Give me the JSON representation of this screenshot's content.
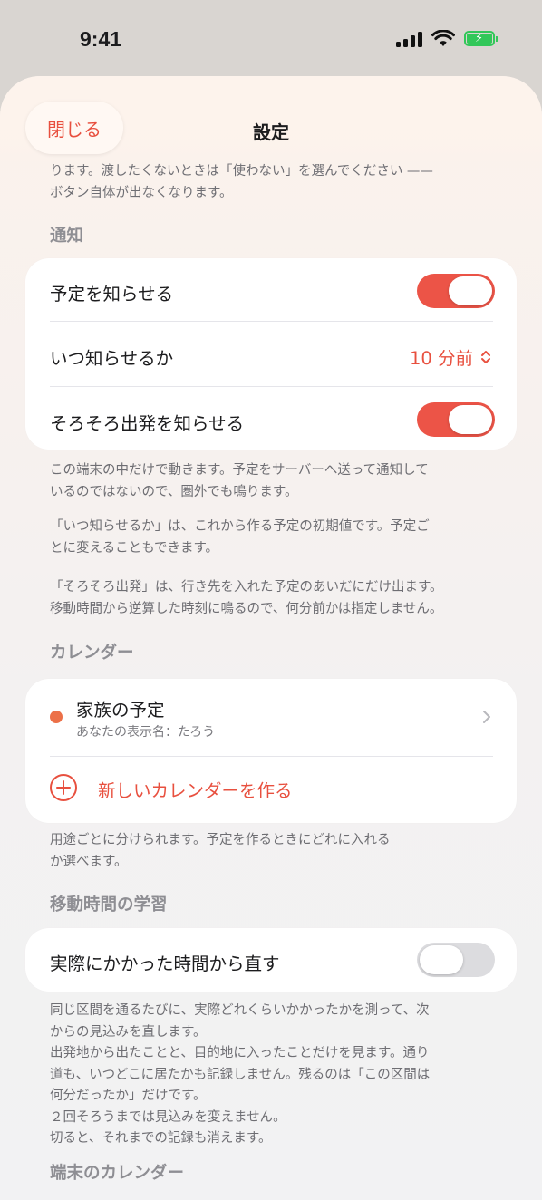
{
  "status_bar": {
    "time": "9:41"
  },
  "nav": {
    "close_label": "閉じる",
    "title": "設定"
  },
  "intro_footnote": "ります。渡したくないときは「使わない」を選んでください ——\nボタン自体が出なくなります。",
  "notifications": {
    "header": "通知",
    "notify_label": "予定を知らせる",
    "notify_on": true,
    "when_label": "いつ知らせるか",
    "when_value": "10 分前",
    "departure_label": "そろそろ出発を知らせる",
    "departure_on": true,
    "footnote_1": "この端末の中だけで動きます。予定をサーバーへ送って通知して\nいるのではないので、圏外でも鳴ります。",
    "footnote_2": "「いつ知らせるか」は、これから作る予定の初期値です。予定ご\nとに変えることもできます。",
    "footnote_3": "「そろそろ出発」は、行き先を入れた予定のあいだにだけ出ます。\n移動時間から逆算した時刻に鳴るので、何分前かは指定しません。"
  },
  "calendars": {
    "header": "カレンダー",
    "items": [
      {
        "name": "家族の予定",
        "subtitle": "あなたの表示名：たろう",
        "color": "#ec7048"
      }
    ],
    "new_label": "新しいカレンダーを作る",
    "footnote": "用途ごとに分けられます。予定を作るときにどれに入れる\nか選べます。"
  },
  "travel_learning": {
    "header": "移動時間の学習",
    "toggle_label": "実際にかかった時間から直す",
    "toggle_on": false,
    "footnote": "同じ区間を通るたびに、実際どれくらいかかったかを測って、次\nからの見込みを直します。\n出発地から出たことと、目的地に入ったことだけを見ます。通り\n道も、いつどこに居たかも記録しません。残るのは「この区間は\n何分だったか」だけです。\n２回そろうまでは見込みを変えません。\n切ると、それまでの記録も消えます。"
  },
  "device_calendar": {
    "header": "端末のカレンダー"
  },
  "colors": {
    "accent": "#e8503f",
    "toggle_on": "#ec5447",
    "toggle_off": "#dcdcdf"
  }
}
